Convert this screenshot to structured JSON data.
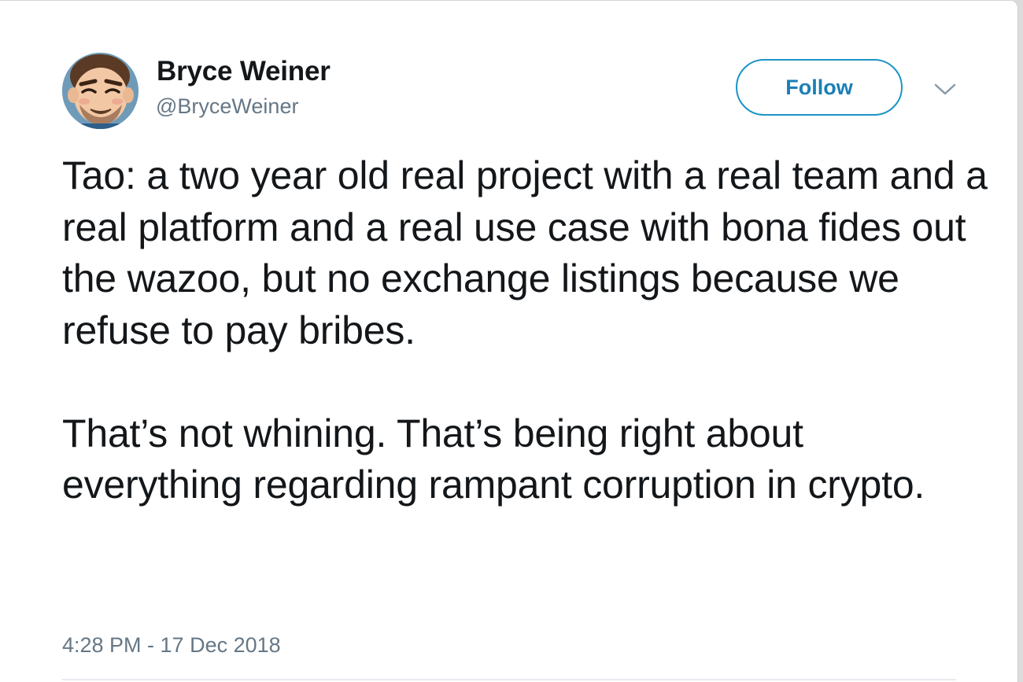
{
  "tweet": {
    "author": {
      "display_name": "Bryce Weiner",
      "handle": "@BryceWeiner",
      "avatar_icon": "cartoon-face-avatar"
    },
    "follow_button_label": "Follow",
    "menu_icon": "chevron-down-icon",
    "paragraphs": [
      "Tao: a two year old real project with a real team and a real platform and a real use case with bona fides out the wazoo, but no exchange listings because we refuse to pay bribes.",
      "That’s not whining. That’s being right about everything regarding rampant corruption in crypto."
    ],
    "timestamp": "4:28 PM - 17 Dec 2018"
  },
  "colors": {
    "accent": "#1b95c6",
    "text": "#14171a",
    "secondary_text": "#657786",
    "divider": "#e6ecf0"
  }
}
